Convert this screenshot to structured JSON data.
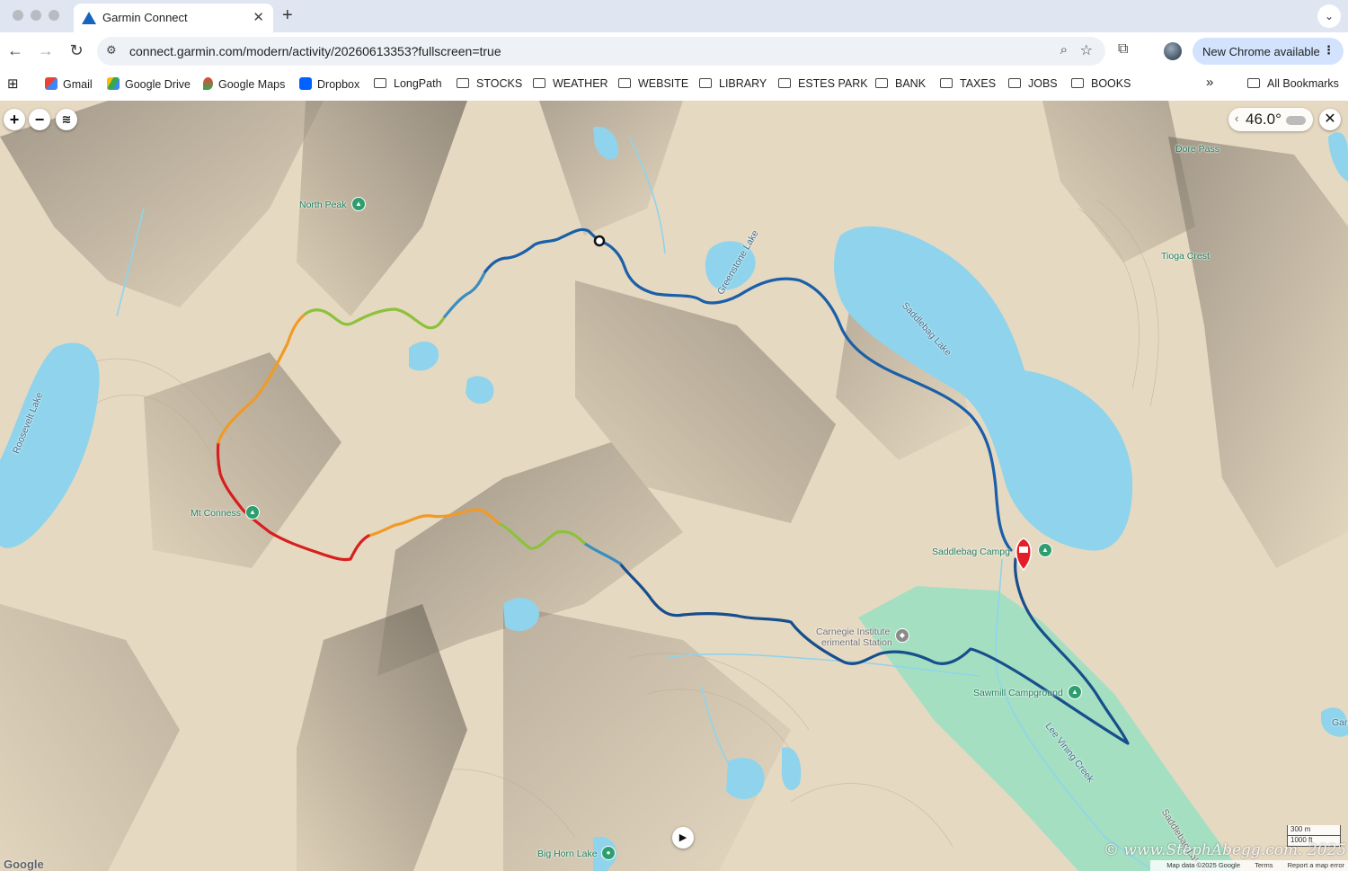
{
  "browser": {
    "tab_title": "Garmin Connect",
    "tab_close": "✕",
    "new_tab": "+",
    "url": "connect.garmin.com/modern/activity/20260613353?fullscreen=true",
    "new_chrome_label": "New Chrome available",
    "bookmarks": [
      {
        "label": "Gmail",
        "type": "site",
        "icon": "gmail-icon"
      },
      {
        "label": "Google Drive",
        "type": "site",
        "icon": "google-drive-icon"
      },
      {
        "label": "Google Maps",
        "type": "site",
        "icon": "google-maps-icon"
      },
      {
        "label": "Dropbox",
        "type": "site",
        "icon": "dropbox-icon"
      },
      {
        "label": "LongPath",
        "type": "folder"
      },
      {
        "label": "STOCKS",
        "type": "folder"
      },
      {
        "label": "WEATHER",
        "type": "folder"
      },
      {
        "label": "WEBSITE",
        "type": "folder"
      },
      {
        "label": "LIBRARY",
        "type": "folder"
      },
      {
        "label": "ESTES PARK",
        "type": "folder"
      },
      {
        "label": "BANK",
        "type": "folder"
      },
      {
        "label": "TAXES",
        "type": "folder"
      },
      {
        "label": "JOBS",
        "type": "folder"
      },
      {
        "label": "BOOKS",
        "type": "folder"
      }
    ],
    "all_bookmarks": "All Bookmarks",
    "overflow": "»"
  },
  "map": {
    "zoom_in": "+",
    "zoom_out": "−",
    "weather_temp": "46.0°",
    "weather_chevron": "‹",
    "close": "✕",
    "labels": {
      "north_peak": "North Peak",
      "mt_conness": "Mt Conness",
      "roosevelt_lake": "Roosevelt Lake",
      "greenstone_lake": "Greenstone Lake",
      "saddlebag_lake": "Saddlebag Lake",
      "dore_pass": "Dore Pass",
      "tioga_crest": "Tioga Crest",
      "saddlebag_campground": "Saddlebag Campg",
      "carnegie_1": "Carnegie Institute",
      "carnegie_2": "erimental Station",
      "sawmill_campground": "Sawmill Campground",
      "lee_vining_creek": "Lee Vining Creek",
      "saddlebag_lake_rd": "Saddlebag Lake Rd",
      "big_horn_lake": "Big Horn Lake",
      "edge_label": "Garc"
    },
    "scale_m": "300 m",
    "scale_ft": "1000 ft",
    "google_logo": "Google",
    "watermark": "© www.StephAbegg.com. 2025",
    "attribution": {
      "map_data": "Map data ©2025 Google",
      "terms": "Terms",
      "report": "Report a map error"
    },
    "track_colors": {
      "low": "#1a5fa8",
      "mid": "#6cb12a",
      "high": "#f09a28",
      "peak": "#d81e1e"
    },
    "water_color": "#8fd4ec",
    "terrain_color": "#e6d9c2"
  }
}
